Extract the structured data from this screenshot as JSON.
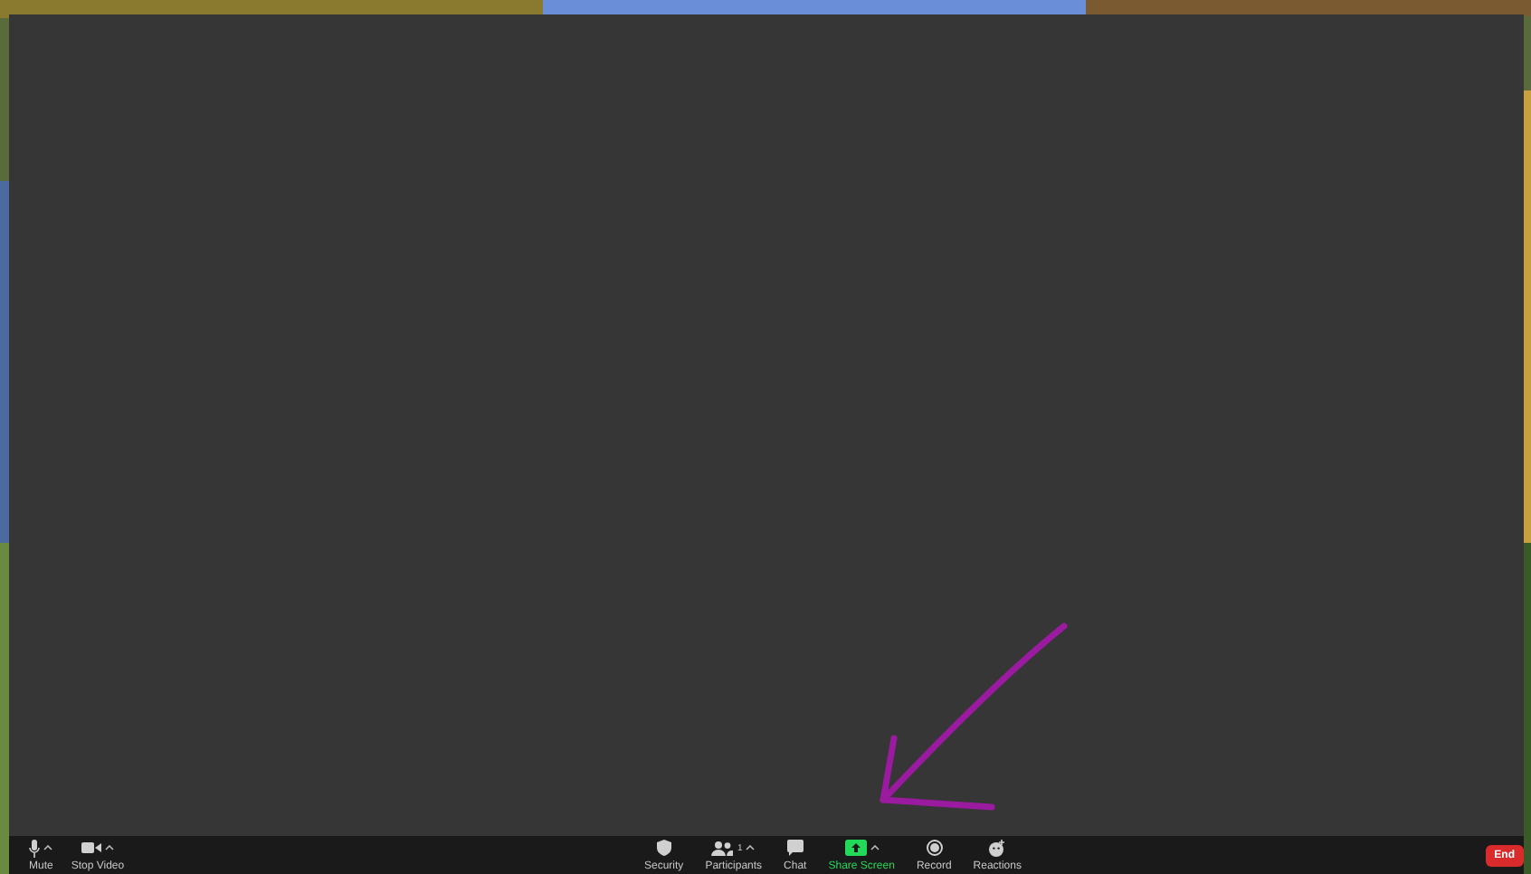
{
  "toolbar": {
    "left": [
      {
        "kind": "mic",
        "label": "Mute",
        "has_menu": true
      },
      {
        "kind": "video",
        "label": "Stop Video",
        "has_menu": true
      }
    ],
    "center": [
      {
        "kind": "security",
        "label": "Security",
        "has_menu": false,
        "active": false
      },
      {
        "kind": "participants",
        "label": "Participants",
        "count": "1",
        "has_menu": true,
        "active": false
      },
      {
        "kind": "chat",
        "label": "Chat",
        "has_menu": false,
        "active": false
      },
      {
        "kind": "share",
        "label": "Share Screen",
        "has_menu": true,
        "active": true
      },
      {
        "kind": "record",
        "label": "Record",
        "has_menu": false,
        "active": false
      },
      {
        "kind": "reactions",
        "label": "Reactions",
        "has_menu": false,
        "active": false
      }
    ],
    "end_button": "End"
  }
}
